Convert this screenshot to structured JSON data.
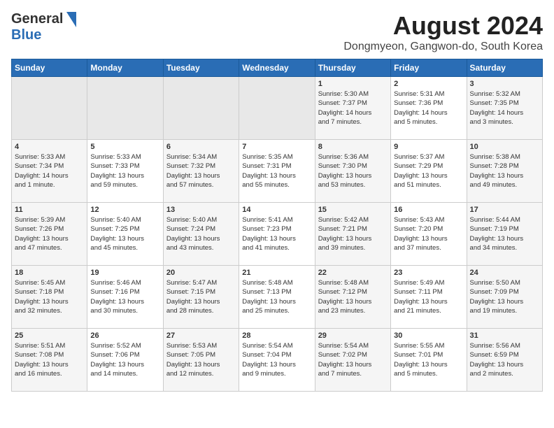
{
  "header": {
    "logo_general": "General",
    "logo_blue": "Blue",
    "title": "August 2024",
    "subtitle": "Dongmyeon, Gangwon-do, South Korea"
  },
  "weekdays": [
    "Sunday",
    "Monday",
    "Tuesday",
    "Wednesday",
    "Thursday",
    "Friday",
    "Saturday"
  ],
  "weeks": [
    [
      {
        "day": "",
        "empty": true
      },
      {
        "day": "",
        "empty": true
      },
      {
        "day": "",
        "empty": true
      },
      {
        "day": "",
        "empty": true
      },
      {
        "day": "1",
        "lines": [
          "Sunrise: 5:30 AM",
          "Sunset: 7:37 PM",
          "Daylight: 14 hours",
          "and 7 minutes."
        ]
      },
      {
        "day": "2",
        "lines": [
          "Sunrise: 5:31 AM",
          "Sunset: 7:36 PM",
          "Daylight: 14 hours",
          "and 5 minutes."
        ]
      },
      {
        "day": "3",
        "lines": [
          "Sunrise: 5:32 AM",
          "Sunset: 7:35 PM",
          "Daylight: 14 hours",
          "and 3 minutes."
        ]
      }
    ],
    [
      {
        "day": "4",
        "lines": [
          "Sunrise: 5:33 AM",
          "Sunset: 7:34 PM",
          "Daylight: 14 hours",
          "and 1 minute."
        ]
      },
      {
        "day": "5",
        "lines": [
          "Sunrise: 5:33 AM",
          "Sunset: 7:33 PM",
          "Daylight: 13 hours",
          "and 59 minutes."
        ]
      },
      {
        "day": "6",
        "lines": [
          "Sunrise: 5:34 AM",
          "Sunset: 7:32 PM",
          "Daylight: 13 hours",
          "and 57 minutes."
        ]
      },
      {
        "day": "7",
        "lines": [
          "Sunrise: 5:35 AM",
          "Sunset: 7:31 PM",
          "Daylight: 13 hours",
          "and 55 minutes."
        ]
      },
      {
        "day": "8",
        "lines": [
          "Sunrise: 5:36 AM",
          "Sunset: 7:30 PM",
          "Daylight: 13 hours",
          "and 53 minutes."
        ]
      },
      {
        "day": "9",
        "lines": [
          "Sunrise: 5:37 AM",
          "Sunset: 7:29 PM",
          "Daylight: 13 hours",
          "and 51 minutes."
        ]
      },
      {
        "day": "10",
        "lines": [
          "Sunrise: 5:38 AM",
          "Sunset: 7:28 PM",
          "Daylight: 13 hours",
          "and 49 minutes."
        ]
      }
    ],
    [
      {
        "day": "11",
        "lines": [
          "Sunrise: 5:39 AM",
          "Sunset: 7:26 PM",
          "Daylight: 13 hours",
          "and 47 minutes."
        ]
      },
      {
        "day": "12",
        "lines": [
          "Sunrise: 5:40 AM",
          "Sunset: 7:25 PM",
          "Daylight: 13 hours",
          "and 45 minutes."
        ]
      },
      {
        "day": "13",
        "lines": [
          "Sunrise: 5:40 AM",
          "Sunset: 7:24 PM",
          "Daylight: 13 hours",
          "and 43 minutes."
        ]
      },
      {
        "day": "14",
        "lines": [
          "Sunrise: 5:41 AM",
          "Sunset: 7:23 PM",
          "Daylight: 13 hours",
          "and 41 minutes."
        ]
      },
      {
        "day": "15",
        "lines": [
          "Sunrise: 5:42 AM",
          "Sunset: 7:21 PM",
          "Daylight: 13 hours",
          "and 39 minutes."
        ]
      },
      {
        "day": "16",
        "lines": [
          "Sunrise: 5:43 AM",
          "Sunset: 7:20 PM",
          "Daylight: 13 hours",
          "and 37 minutes."
        ]
      },
      {
        "day": "17",
        "lines": [
          "Sunrise: 5:44 AM",
          "Sunset: 7:19 PM",
          "Daylight: 13 hours",
          "and 34 minutes."
        ]
      }
    ],
    [
      {
        "day": "18",
        "lines": [
          "Sunrise: 5:45 AM",
          "Sunset: 7:18 PM",
          "Daylight: 13 hours",
          "and 32 minutes."
        ]
      },
      {
        "day": "19",
        "lines": [
          "Sunrise: 5:46 AM",
          "Sunset: 7:16 PM",
          "Daylight: 13 hours",
          "and 30 minutes."
        ]
      },
      {
        "day": "20",
        "lines": [
          "Sunrise: 5:47 AM",
          "Sunset: 7:15 PM",
          "Daylight: 13 hours",
          "and 28 minutes."
        ]
      },
      {
        "day": "21",
        "lines": [
          "Sunrise: 5:48 AM",
          "Sunset: 7:13 PM",
          "Daylight: 13 hours",
          "and 25 minutes."
        ]
      },
      {
        "day": "22",
        "lines": [
          "Sunrise: 5:48 AM",
          "Sunset: 7:12 PM",
          "Daylight: 13 hours",
          "and 23 minutes."
        ]
      },
      {
        "day": "23",
        "lines": [
          "Sunrise: 5:49 AM",
          "Sunset: 7:11 PM",
          "Daylight: 13 hours",
          "and 21 minutes."
        ]
      },
      {
        "day": "24",
        "lines": [
          "Sunrise: 5:50 AM",
          "Sunset: 7:09 PM",
          "Daylight: 13 hours",
          "and 19 minutes."
        ]
      }
    ],
    [
      {
        "day": "25",
        "lines": [
          "Sunrise: 5:51 AM",
          "Sunset: 7:08 PM",
          "Daylight: 13 hours",
          "and 16 minutes."
        ]
      },
      {
        "day": "26",
        "lines": [
          "Sunrise: 5:52 AM",
          "Sunset: 7:06 PM",
          "Daylight: 13 hours",
          "and 14 minutes."
        ]
      },
      {
        "day": "27",
        "lines": [
          "Sunrise: 5:53 AM",
          "Sunset: 7:05 PM",
          "Daylight: 13 hours",
          "and 12 minutes."
        ]
      },
      {
        "day": "28",
        "lines": [
          "Sunrise: 5:54 AM",
          "Sunset: 7:04 PM",
          "Daylight: 13 hours",
          "and 9 minutes."
        ]
      },
      {
        "day": "29",
        "lines": [
          "Sunrise: 5:54 AM",
          "Sunset: 7:02 PM",
          "Daylight: 13 hours",
          "and 7 minutes."
        ]
      },
      {
        "day": "30",
        "lines": [
          "Sunrise: 5:55 AM",
          "Sunset: 7:01 PM",
          "Daylight: 13 hours",
          "and 5 minutes."
        ]
      },
      {
        "day": "31",
        "lines": [
          "Sunrise: 5:56 AM",
          "Sunset: 6:59 PM",
          "Daylight: 13 hours",
          "and 2 minutes."
        ]
      }
    ]
  ]
}
